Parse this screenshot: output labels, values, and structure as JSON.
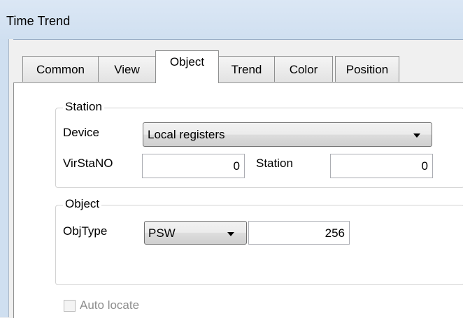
{
  "window": {
    "title": "Time Trend"
  },
  "tabs": [
    {
      "label": "Common",
      "active": false
    },
    {
      "label": "View",
      "active": false
    },
    {
      "label": "Object",
      "active": true
    },
    {
      "label": "Trend",
      "active": false
    },
    {
      "label": "Color",
      "active": false
    },
    {
      "label": "Position",
      "active": false
    }
  ],
  "station_group": {
    "title": "Station",
    "device_label": "Device",
    "device_value": "Local registers",
    "virstano_label": "VirStaNO",
    "virstano_value": "0",
    "station_label": "Station",
    "station_value": "0"
  },
  "object_group": {
    "title": "Object",
    "objtype_label": "ObjType",
    "objtype_value": "PSW",
    "address_value": "256"
  },
  "auto_locate": {
    "label": "Auto locate",
    "checked": false,
    "enabled": false
  },
  "icons": {
    "dropdown": "chevron-down-icon"
  }
}
